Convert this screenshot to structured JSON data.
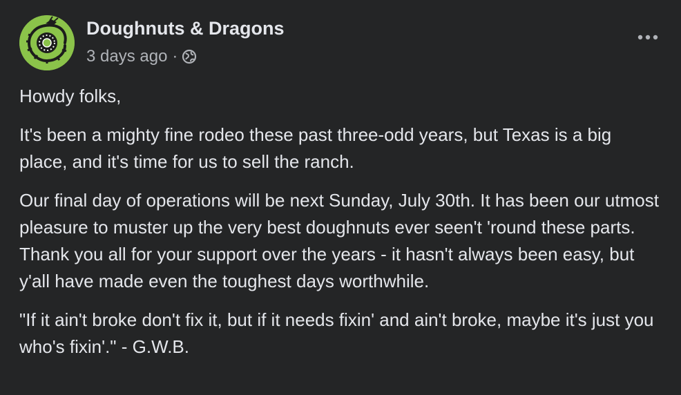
{
  "post": {
    "author": "Doughnuts & Dragons",
    "time": "3 days ago",
    "separator": "·",
    "audience_icon": "globe-icon",
    "more_icon": "more-options-icon",
    "avatar_icon": "dragon-doughnut-logo",
    "paragraphs": [
      "Howdy folks,",
      "It's been a mighty fine rodeo these past three-odd years, but Texas is a big place, and it's time for us to sell the ranch.",
      "Our final day of operations will be next Sunday, July 30th. It has been our utmost pleasure to muster up the very best doughnuts ever seen't 'round these parts. Thank you all for your support over the years - it hasn't always been easy, but y'all have made even the toughest days worthwhile.",
      "\"If it ain't broke don't fix it, but if it needs fixin' and ain't broke, maybe it's just you who's fixin'.\" - G.W.B."
    ]
  },
  "colors": {
    "background": "#242526",
    "primary_text": "#e4e6eb",
    "secondary_text": "#b0b3b8",
    "avatar_bg": "#8bc34a"
  }
}
